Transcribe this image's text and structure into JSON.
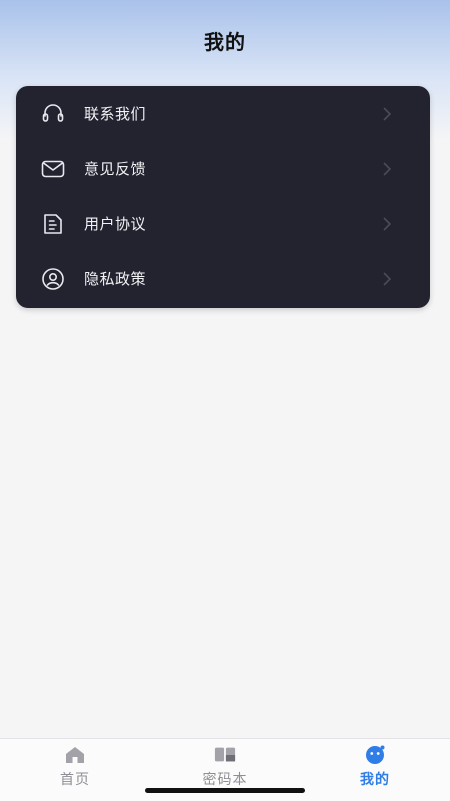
{
  "header": {
    "title": "我的"
  },
  "menu": {
    "items": [
      {
        "label": "联系我们",
        "icon": "headset-icon"
      },
      {
        "label": "意见反馈",
        "icon": "envelope-icon"
      },
      {
        "label": "用户协议",
        "icon": "document-icon"
      },
      {
        "label": "隐私政策",
        "icon": "privacy-face-icon"
      }
    ]
  },
  "tabbar": {
    "tabs": [
      {
        "label": "首页",
        "icon": "home-icon",
        "active": false
      },
      {
        "label": "密码本",
        "icon": "notebook-icon",
        "active": false
      },
      {
        "label": "我的",
        "icon": "profile-face-icon",
        "active": true
      }
    ]
  },
  "colors": {
    "card_background": "#232330",
    "accent_blue": "#2f7de6",
    "tab_inactive": "#8e8e95",
    "header_gradient_top": "#a9c2ea"
  }
}
